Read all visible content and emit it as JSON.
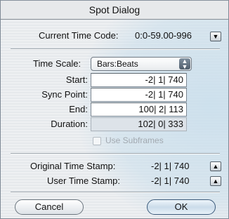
{
  "window": {
    "title": "Spot Dialog"
  },
  "current_time_code": {
    "label": "Current Time Code:",
    "value": "0:0-59.00-996",
    "menu_icon": "triangle-down"
  },
  "time_scale": {
    "label": "Time Scale:",
    "selected": "Bars:Beats"
  },
  "fields": {
    "start": {
      "label": "Start:",
      "value": "-2| 1| 740"
    },
    "sync_point": {
      "label": "Sync Point:",
      "value": "-2| 1| 740"
    },
    "end": {
      "label": "End:",
      "value": "100| 2| 113"
    },
    "duration": {
      "label": "Duration:",
      "value": "102| 0| 333"
    }
  },
  "use_subframes": {
    "label": "Use Subframes",
    "checked": false,
    "enabled": false
  },
  "stamps": {
    "original": {
      "label": "Original Time Stamp:",
      "value": "-2| 1| 740",
      "button_icon": "triangle-up"
    },
    "user": {
      "label": "User Time Stamp:",
      "value": "-2| 1| 740",
      "button_icon": "triangle-up"
    }
  },
  "buttons": {
    "cancel": "Cancel",
    "ok": "OK"
  },
  "colors": {
    "default_button": "#cbdcea",
    "readonly_field": "#dde3e9"
  }
}
